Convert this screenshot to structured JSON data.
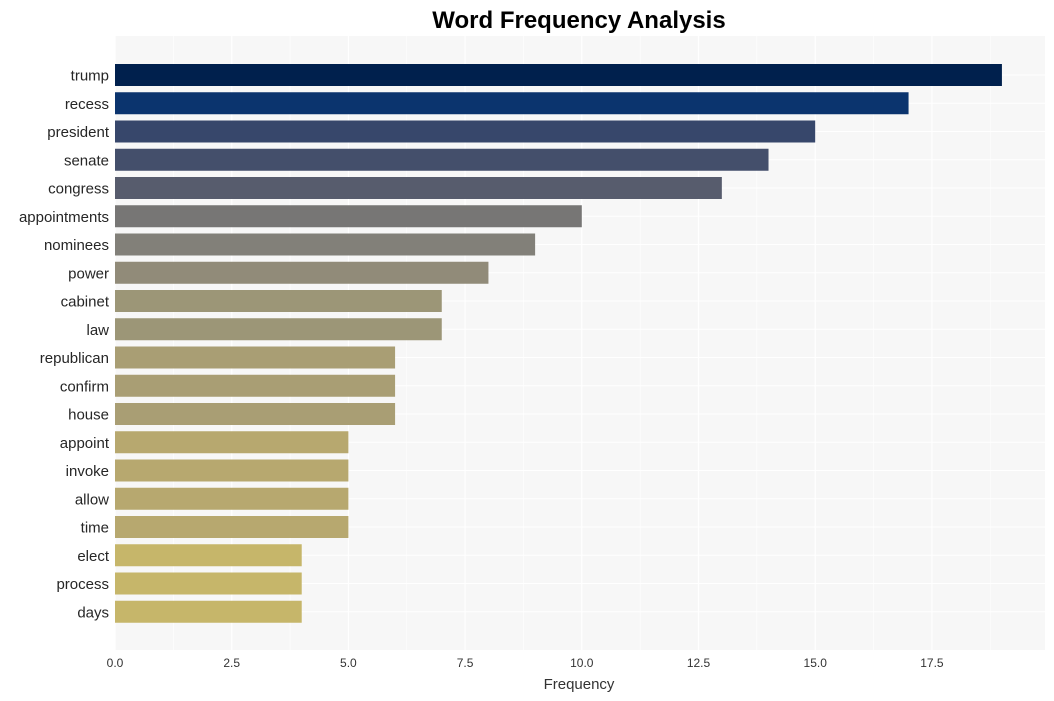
{
  "chart_data": {
    "type": "bar",
    "orientation": "horizontal",
    "title": "Word Frequency Analysis",
    "xlabel": "Frequency",
    "ylabel": "",
    "xlim": [
      0,
      19.95
    ],
    "xticks": [
      0.0,
      2.5,
      5.0,
      7.5,
      10.0,
      12.5,
      15.0,
      17.5
    ],
    "xtick_labels": [
      "0.0",
      "2.5",
      "5.0",
      "7.5",
      "10.0",
      "12.5",
      "15.0",
      "17.5"
    ],
    "grid": true,
    "categories": [
      "trump",
      "recess",
      "president",
      "senate",
      "congress",
      "appointments",
      "nominees",
      "power",
      "cabinet",
      "law",
      "republican",
      "confirm",
      "house",
      "appoint",
      "invoke",
      "allow",
      "time",
      "elect",
      "process",
      "days"
    ],
    "values": [
      19,
      17,
      15,
      14,
      13,
      10,
      9,
      8,
      7,
      7,
      6,
      6,
      6,
      5,
      5,
      5,
      5,
      4,
      4,
      4
    ],
    "colors": [
      "#00204d",
      "#0b346e",
      "#37476b",
      "#444f6b",
      "#575c6d",
      "#777675",
      "#828079",
      "#918b79",
      "#9c9677",
      "#9c9677",
      "#a99e74",
      "#a99e74",
      "#a99e74",
      "#b7a86f",
      "#b7a86f",
      "#b7a86f",
      "#b7a86f",
      "#c6b66a",
      "#c6b66a",
      "#c6b66a"
    ]
  }
}
